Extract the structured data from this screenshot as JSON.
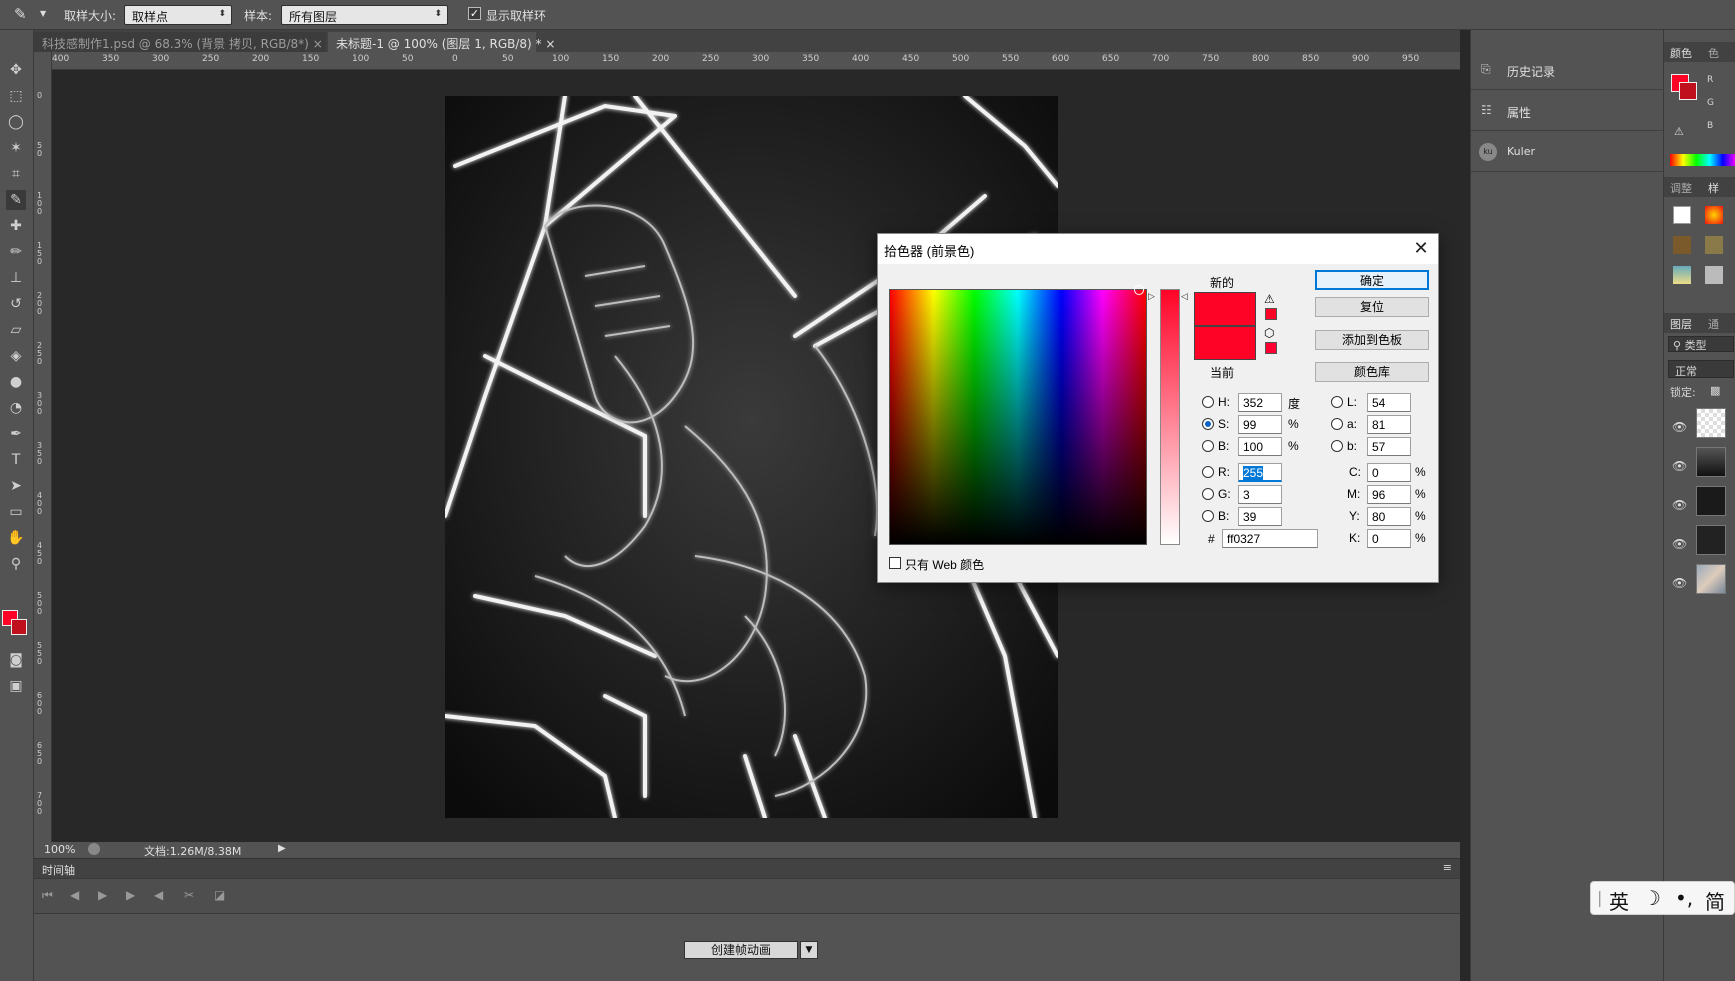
{
  "options_bar": {
    "sample_size_label": "取样大小:",
    "sample_size_value": "取样点",
    "sample_label": "样本:",
    "sample_value": "所有图层",
    "show_ring_label": "显示取样环"
  },
  "tabs": [
    {
      "label": "科技感制作1.psd @ 68.3% (背景 拷贝, RGB/8*)"
    },
    {
      "label": "未标题-1 @ 100% (图层 1, RGB/8) *"
    }
  ],
  "ruler_top": [
    "400",
    "350",
    "300",
    "250",
    "200",
    "150",
    "100",
    "50",
    "0",
    "50",
    "100",
    "150",
    "200",
    "250",
    "300",
    "350",
    "400",
    "450",
    "500",
    "550",
    "600",
    "650",
    "700",
    "750",
    "800",
    "850",
    "900",
    "950"
  ],
  "ruler_left": [
    "0",
    "50",
    "100",
    "150",
    "200",
    "250",
    "300",
    "350",
    "400",
    "450",
    "500",
    "550",
    "600",
    "650",
    "700"
  ],
  "status": {
    "zoom": "100%",
    "doc": "文档:1.26M/8.38M"
  },
  "timeline": {
    "title": "时间轴",
    "create_button": "创建帧动画"
  },
  "right_dock": [
    {
      "label": "历史记录",
      "icon": "history-icon"
    },
    {
      "label": "属性",
      "icon": "properties-icon"
    },
    {
      "label": "Kuler",
      "icon": "kuler-icon"
    }
  ],
  "far_right": {
    "color_tab": "颜色",
    "color_tab2": "色",
    "adjust_tab": "调整",
    "style_tab": "样",
    "layers_tab": "图层",
    "channels_tab": "通",
    "kind_label": "类型",
    "blend_mode": "正常",
    "lock_label": "锁定:",
    "r_label": "R",
    "g_label": "G",
    "b_label": "B"
  },
  "dialog": {
    "title": "拾色器 (前景色)",
    "new_label": "新的",
    "current_label": "当前",
    "ok": "确定",
    "reset": "复位",
    "add_swatch": "添加到色板",
    "color_library": "颜色库",
    "web_only": "只有 Web 颜色",
    "fields": {
      "H": {
        "label": "H:",
        "value": "352",
        "unit": "度"
      },
      "S": {
        "label": "S:",
        "value": "99",
        "unit": "%"
      },
      "Bv": {
        "label": "B:",
        "value": "100",
        "unit": "%"
      },
      "R": {
        "label": "R:",
        "value": "255"
      },
      "G": {
        "label": "G:",
        "value": "3"
      },
      "Bb": {
        "label": "B:",
        "value": "39"
      },
      "L": {
        "label": "L:",
        "value": "54"
      },
      "a": {
        "label": "a:",
        "value": "81"
      },
      "b": {
        "label": "b:",
        "value": "57"
      },
      "C": {
        "label": "C:",
        "value": "0",
        "unit": "%"
      },
      "M": {
        "label": "M:",
        "value": "96",
        "unit": "%"
      },
      "Y": {
        "label": "Y:",
        "value": "80",
        "unit": "%"
      },
      "K": {
        "label": "K:",
        "value": "0",
        "unit": "%"
      }
    },
    "hash": "#",
    "hex": "ff0327",
    "color": "#ff0327"
  },
  "ime": {
    "lang": "英",
    "moon": "☽",
    "punct": "•,",
    "mode": "简"
  }
}
